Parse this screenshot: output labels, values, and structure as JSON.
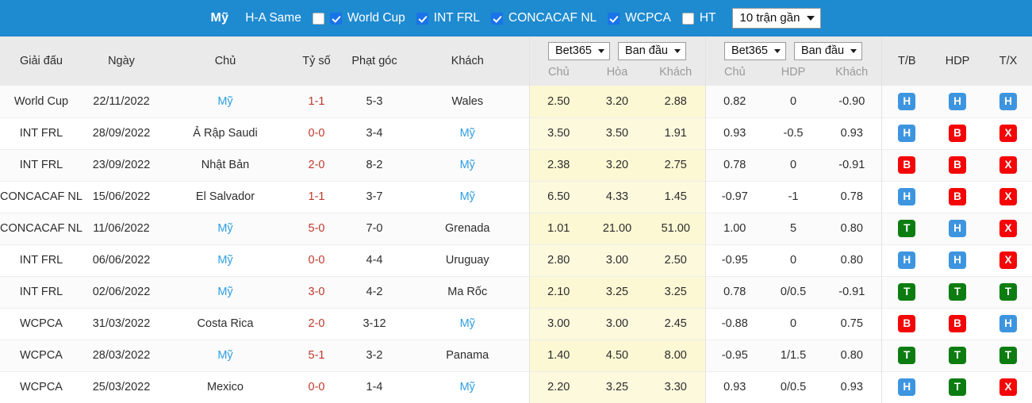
{
  "topbar": {
    "team": "Mỹ",
    "filters": [
      {
        "label": "H-A Same",
        "checked": false,
        "position": "label-first"
      },
      {
        "label": "World Cup",
        "checked": true,
        "position": "check-first"
      },
      {
        "label": "INT FRL",
        "checked": true,
        "position": "check-first"
      },
      {
        "label": "CONCACAF NL",
        "checked": true,
        "position": "check-first"
      },
      {
        "label": "WCPCA",
        "checked": true,
        "position": "check-first"
      },
      {
        "label": "HT",
        "checked": false,
        "position": "check-first"
      }
    ],
    "match_count_select": "10 trận gần"
  },
  "table": {
    "headers": {
      "league": "Giải đấu",
      "date": "Ngày",
      "home": "Chủ",
      "score": "Tỷ số",
      "corners": "Phạt góc",
      "away": "Khách",
      "tb": "T/B",
      "hdp_badge": "HDP",
      "tx": "T/X"
    },
    "odds_group_1": {
      "bookmaker": "Bet365",
      "phase": "Ban đầu",
      "cols": [
        "Chủ",
        "Hòa",
        "Khách"
      ]
    },
    "odds_group_2": {
      "bookmaker": "Bet365",
      "phase": "Ban đầu",
      "cols": [
        "Chủ",
        "HDP",
        "Khách"
      ]
    },
    "rows": [
      {
        "league": "World Cup",
        "date": "22/11/2022",
        "home": "Mỹ",
        "home_highlight": true,
        "score": "1-1",
        "corners": "5-3",
        "away": "Wales",
        "away_highlight": false,
        "o1": "2.50",
        "o2": "3.20",
        "o3": "2.88",
        "a1": "0.82",
        "a2": "0",
        "a3": "-0.90",
        "tb": "H",
        "hdp": "H",
        "tx": "H"
      },
      {
        "league": "INT FRL",
        "date": "28/09/2022",
        "home": "Ả Rập Saudi",
        "home_highlight": false,
        "score": "0-0",
        "corners": "3-4",
        "away": "Mỹ",
        "away_highlight": true,
        "o1": "3.50",
        "o2": "3.50",
        "o3": "1.91",
        "a1": "0.93",
        "a2": "-0.5",
        "a3": "0.93",
        "tb": "H",
        "hdp": "B",
        "tx": "X"
      },
      {
        "league": "INT FRL",
        "date": "23/09/2022",
        "home": "Nhật Bản",
        "home_highlight": false,
        "score": "2-0",
        "corners": "8-2",
        "away": "Mỹ",
        "away_highlight": true,
        "o1": "2.38",
        "o2": "3.20",
        "o3": "2.75",
        "a1": "0.78",
        "a2": "0",
        "a3": "-0.91",
        "tb": "B",
        "hdp": "B",
        "tx": "X"
      },
      {
        "league": "CONCACAF NL",
        "date": "15/06/2022",
        "home": "El Salvador",
        "home_highlight": false,
        "score": "1-1",
        "corners": "3-7",
        "away": "Mỹ",
        "away_highlight": true,
        "o1": "6.50",
        "o2": "4.33",
        "o3": "1.45",
        "a1": "-0.97",
        "a2": "-1",
        "a3": "0.78",
        "tb": "H",
        "hdp": "B",
        "tx": "X"
      },
      {
        "league": "CONCACAF NL",
        "date": "11/06/2022",
        "home": "Mỹ",
        "home_highlight": true,
        "score": "5-0",
        "corners": "7-0",
        "away": "Grenada",
        "away_highlight": false,
        "o1": "1.01",
        "o2": "21.00",
        "o3": "51.00",
        "a1": "1.00",
        "a2": "5",
        "a3": "0.80",
        "tb": "T",
        "hdp": "H",
        "tx": "X"
      },
      {
        "league": "INT FRL",
        "date": "06/06/2022",
        "home": "Mỹ",
        "home_highlight": true,
        "score": "0-0",
        "corners": "4-4",
        "away": "Uruguay",
        "away_highlight": false,
        "o1": "2.80",
        "o2": "3.00",
        "o3": "2.50",
        "a1": "-0.95",
        "a2": "0",
        "a3": "0.80",
        "tb": "H",
        "hdp": "H",
        "tx": "X"
      },
      {
        "league": "INT FRL",
        "date": "02/06/2022",
        "home": "Mỹ",
        "home_highlight": true,
        "score": "3-0",
        "corners": "4-2",
        "away": "Ma Rốc",
        "away_highlight": false,
        "o1": "2.10",
        "o2": "3.25",
        "o3": "3.25",
        "a1": "0.78",
        "a2": "0/0.5",
        "a3": "-0.91",
        "tb": "T",
        "hdp": "T",
        "tx": "T"
      },
      {
        "league": "WCPCA",
        "date": "31/03/2022",
        "home": "Costa Rica",
        "home_highlight": false,
        "score": "2-0",
        "corners": "3-12",
        "away": "Mỹ",
        "away_highlight": true,
        "o1": "3.00",
        "o2": "3.00",
        "o3": "2.45",
        "a1": "-0.88",
        "a2": "0",
        "a3": "0.75",
        "tb": "B",
        "hdp": "B",
        "tx": "H"
      },
      {
        "league": "WCPCA",
        "date": "28/03/2022",
        "home": "Mỹ",
        "home_highlight": true,
        "score": "5-1",
        "corners": "3-2",
        "away": "Panama",
        "away_highlight": false,
        "o1": "1.40",
        "o2": "4.50",
        "o3": "8.00",
        "a1": "-0.95",
        "a2": "1/1.5",
        "a3": "0.80",
        "tb": "T",
        "hdp": "T",
        "tx": "T"
      },
      {
        "league": "WCPCA",
        "date": "25/03/2022",
        "home": "Mexico",
        "home_highlight": false,
        "score": "0-0",
        "corners": "1-4",
        "away": "Mỹ",
        "away_highlight": true,
        "o1": "2.20",
        "o2": "3.25",
        "o3": "3.30",
        "a1": "0.93",
        "a2": "0/0.5",
        "a3": "0.93",
        "tb": "H",
        "hdp": "T",
        "tx": "X"
      }
    ]
  },
  "colors": {
    "topbar_blue": "#1e8ad0",
    "odds_yellow": "#fcf8d3",
    "link_blue": "#2f9fe0",
    "score_red": "#c0392b",
    "badge_h": "#3d95e0",
    "badge_b": "#f40606",
    "badge_t": "#0d7d12",
    "badge_x": "#f40606"
  }
}
